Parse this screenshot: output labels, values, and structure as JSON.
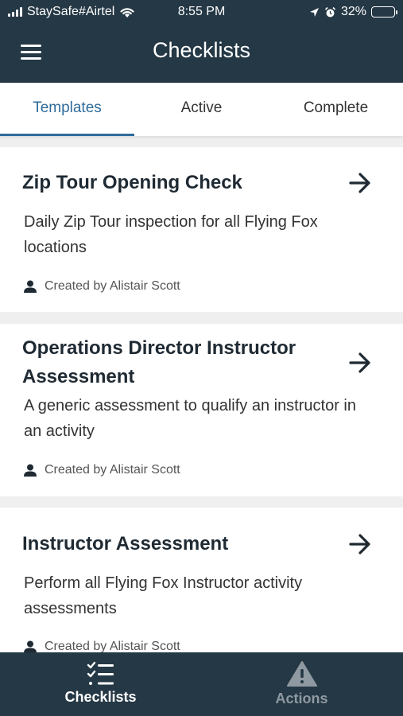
{
  "status_bar": {
    "carrier": "StaySafe#Airtel",
    "time": "8:55 PM",
    "battery": "32%",
    "battery_level": 0.32
  },
  "header": {
    "title": "Checklists",
    "menu_icon": "hamburger-menu-icon"
  },
  "tabs": [
    {
      "label": "Templates",
      "active": true
    },
    {
      "label": "Active",
      "active": false
    },
    {
      "label": "Complete",
      "active": false
    }
  ],
  "cards": [
    {
      "title": "Zip Tour Opening Check",
      "description": "Daily Zip Tour inspection for all Flying Fox locations",
      "created_by": "Created by Alistair Scott"
    },
    {
      "title": "Operations Director Instructor Assessment",
      "description": "A generic assessment to qualify an instructor in an activity",
      "created_by": "Created by Alistair Scott"
    },
    {
      "title": "Instructor Assessment",
      "description": "Perform all Flying Fox Instructor activity assessments",
      "created_by": "Created by Alistair Scott"
    }
  ],
  "bottom_nav": [
    {
      "label": "Checklists",
      "icon": "checklist-icon",
      "active": true
    },
    {
      "label": "Actions",
      "icon": "warning-triangle-icon",
      "active": false
    }
  ],
  "colors": {
    "header_bg": "#253845",
    "accent": "#2f6b9a",
    "page_bg": "#efefef",
    "inactive_nav": "#8f99a1"
  }
}
